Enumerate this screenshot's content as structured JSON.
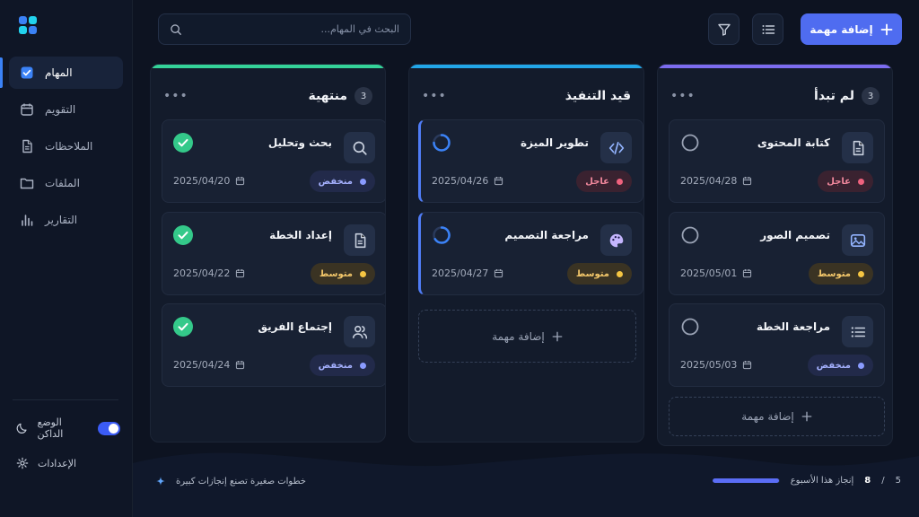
{
  "sidebar": {
    "items": [
      {
        "label": "المهام",
        "icon": "check-square-icon",
        "active": true
      },
      {
        "label": "التقويم",
        "icon": "calendar-icon"
      },
      {
        "label": "الملاحظات",
        "icon": "document-icon"
      },
      {
        "label": "الملفات",
        "icon": "folder-icon"
      },
      {
        "label": "التقارير",
        "icon": "bar-chart-icon"
      }
    ],
    "dark_mode_label": "الوضع الداكن",
    "dark_mode_on": true,
    "settings_label": "الإعدادات"
  },
  "toolbar": {
    "search_placeholder": "البحث في المهام...",
    "add_task_label": "إضافة مهمة"
  },
  "columns": {
    "todo": {
      "title": "لم تبدأ",
      "count": "3",
      "accent": "#7c6cf0",
      "cards": [
        {
          "title": "كتابة المحتوى",
          "date": "2025/04/28",
          "priority": "عاجل",
          "icon": "document-icon"
        },
        {
          "title": "تصميم الصور",
          "date": "2025/05/01",
          "priority": "متوسط",
          "icon": "image-icon"
        },
        {
          "title": "مراجعة الخطة",
          "date": "2025/05/03",
          "priority": "منخفض",
          "icon": "list-icon"
        }
      ],
      "add_label": "إضافة مهمة"
    },
    "progress": {
      "title": "قيد التنفيذ",
      "accent": "#22a6e8",
      "cards": [
        {
          "title": "تطوير الميزة",
          "date": "2025/04/26",
          "priority": "عاجل",
          "icon": "code-icon"
        },
        {
          "title": "مراجعة التصميم",
          "date": "2025/04/27",
          "priority": "متوسط",
          "icon": "palette-icon"
        }
      ],
      "add_label": "إضافة مهمة"
    },
    "done": {
      "title": "منتهية",
      "count": "3",
      "accent": "#34d399",
      "cards": [
        {
          "title": "بحث وتحليل",
          "date": "2025/04/20",
          "priority": "منخفض",
          "icon": "search-icon"
        },
        {
          "title": "إعداد الخطة",
          "date": "2025/04/22",
          "priority": "متوسط",
          "icon": "document-icon"
        },
        {
          "title": "إجتماع الفريق",
          "date": "2025/04/24",
          "priority": "منخفض",
          "icon": "users-icon"
        }
      ]
    }
  },
  "footer": {
    "motto": "خطوات صغيرة تصنع إنجازات كبيرة",
    "weekly_label": "إنجاز هذا الأسبوع",
    "weekly_done": "8",
    "weekly_sep": "/",
    "weekly_total": "5",
    "weekly_fraction": 0.99
  }
}
